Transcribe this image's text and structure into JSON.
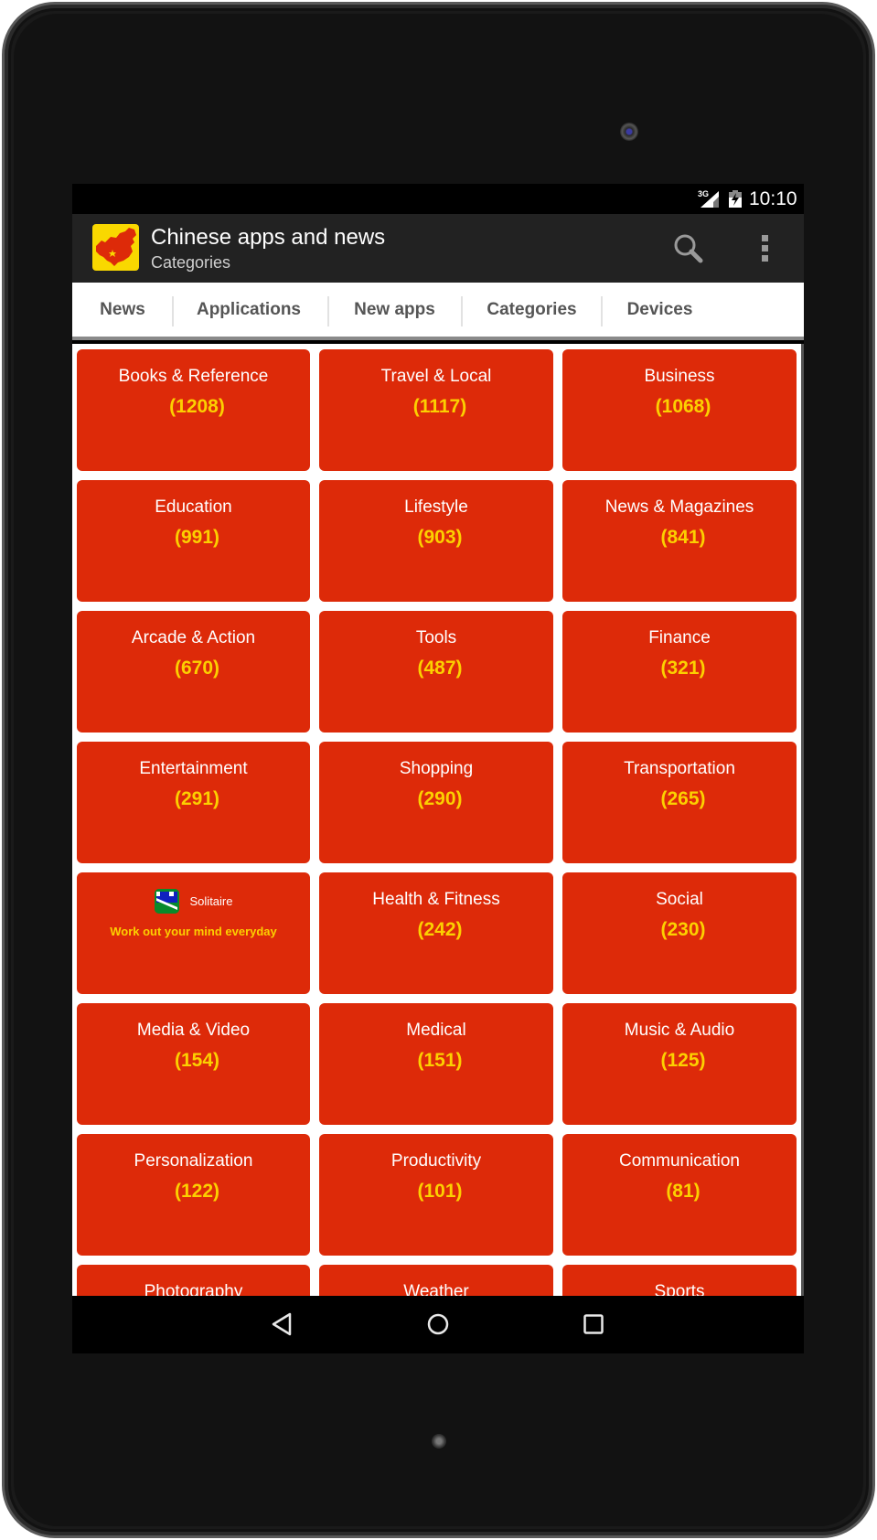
{
  "status_bar": {
    "network": "3G",
    "time": "10:10"
  },
  "action_bar": {
    "title": "Chinese apps and news",
    "subtitle": "Categories",
    "icons": [
      "app-logo-china-map",
      "search-icon",
      "overflow-menu-icon"
    ]
  },
  "tabs": [
    {
      "label": "News"
    },
    {
      "label": "Applications"
    },
    {
      "label": "New apps"
    },
    {
      "label": "Categories"
    },
    {
      "label": "Devices"
    }
  ],
  "categories": [
    {
      "name": "Books & Reference",
      "count": "(1208)"
    },
    {
      "name": "Travel & Local",
      "count": "(1117)"
    },
    {
      "name": "Business",
      "count": "(1068)"
    },
    {
      "name": "Education",
      "count": "(991)"
    },
    {
      "name": "Lifestyle",
      "count": "(903)"
    },
    {
      "name": "News & Magazines",
      "count": "(841)"
    },
    {
      "name": "Arcade & Action",
      "count": "(670)"
    },
    {
      "name": "Tools",
      "count": "(487)"
    },
    {
      "name": "Finance",
      "count": "(321)"
    },
    {
      "name": "Entertainment",
      "count": "(291)"
    },
    {
      "name": "Shopping",
      "count": "(290)"
    },
    {
      "name": "Transportation",
      "count": "(265)"
    },
    {
      "name": "Health & Fitness",
      "count": "(242)"
    },
    {
      "name": "Social",
      "count": "(230)"
    },
    {
      "name": "Media & Video",
      "count": "(154)"
    },
    {
      "name": "Medical",
      "count": "(151)"
    },
    {
      "name": "Music & Audio",
      "count": "(125)"
    },
    {
      "name": "Personalization",
      "count": "(122)"
    },
    {
      "name": "Productivity",
      "count": "(101)"
    },
    {
      "name": "Communication",
      "count": "(81)"
    },
    {
      "name": "Photography",
      "count": ""
    },
    {
      "name": "Weather",
      "count": ""
    },
    {
      "name": "Sports",
      "count": ""
    }
  ],
  "ad": {
    "app_name": "Solitaire",
    "tagline": "Work out your mind everyday",
    "icon": "solitaire-app-icon"
  },
  "nav_bar": {
    "icons": [
      "back-icon",
      "home-icon",
      "recents-icon"
    ]
  },
  "colors": {
    "card_bg": "#dd2a09",
    "count_text": "#fcd000",
    "action_bar": "#222222",
    "logo_bg": "#f9d800"
  }
}
